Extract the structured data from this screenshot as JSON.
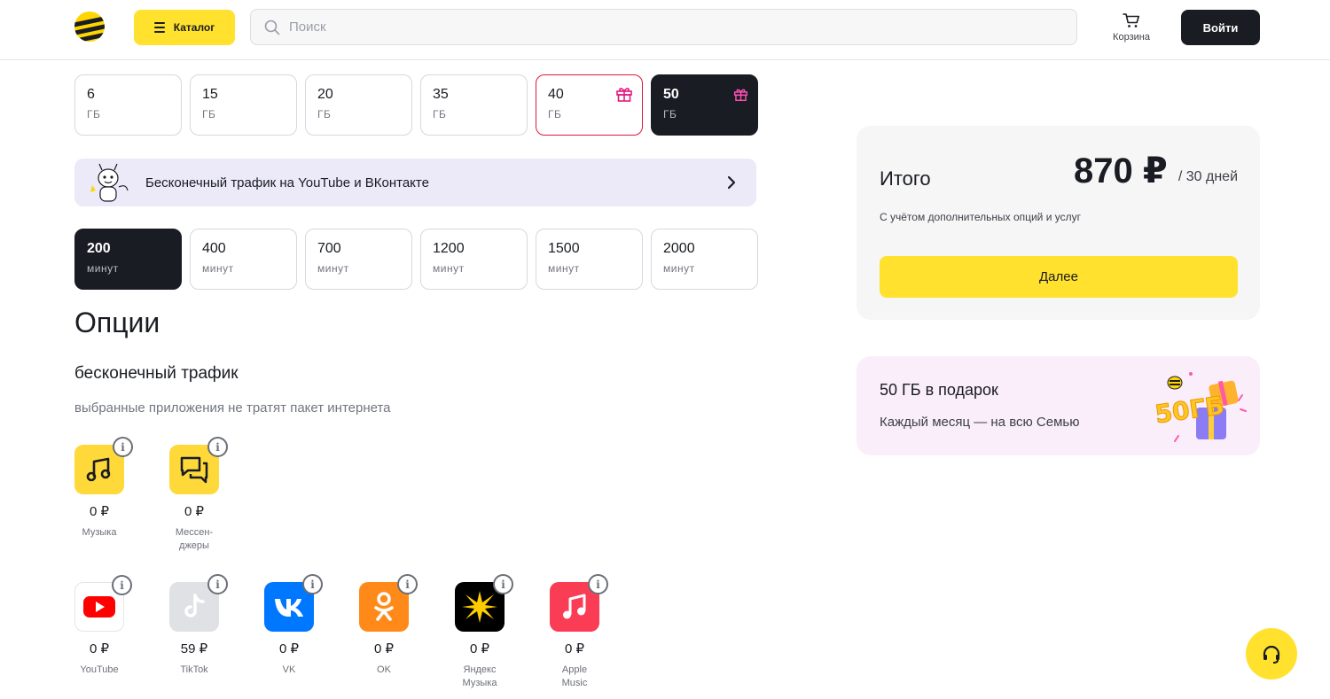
{
  "header": {
    "catalog_label": "Каталог",
    "search_placeholder": "Поиск",
    "search_value": "",
    "cart_label": "Корзина",
    "login_label": "Войти",
    "brand_color": "#ffe12e"
  },
  "traffic_options": [
    {
      "value": "6",
      "unit": "ГБ",
      "state": "default",
      "gift": false
    },
    {
      "value": "15",
      "unit": "ГБ",
      "state": "default",
      "gift": false
    },
    {
      "value": "20",
      "unit": "ГБ",
      "state": "default",
      "gift": false
    },
    {
      "value": "35",
      "unit": "ГБ",
      "state": "default",
      "gift": false
    },
    {
      "value": "40",
      "unit": "ГБ",
      "state": "outlined-red",
      "gift": true
    },
    {
      "value": "50",
      "unit": "ГБ",
      "state": "selected",
      "gift": true
    }
  ],
  "promo_banner": {
    "text": "Бесконечный трафик на YouTube и ВКонтакте",
    "background": "#ece9f8"
  },
  "minutes_options": [
    {
      "value": "200",
      "unit": "минут",
      "state": "selected"
    },
    {
      "value": "400",
      "unit": "минут",
      "state": "default"
    },
    {
      "value": "700",
      "unit": "минут",
      "state": "default"
    },
    {
      "value": "1200",
      "unit": "минут",
      "state": "default"
    },
    {
      "value": "1500",
      "unit": "минут",
      "state": "default"
    },
    {
      "value": "2000",
      "unit": "минут",
      "state": "default"
    }
  ],
  "options": {
    "title": "Опции",
    "unlimited": {
      "title": "бесконечный трафик",
      "description": "выбранные приложения не тратят пакет интернета"
    },
    "apps_row1": [
      {
        "name": "Музыка",
        "price": "0 ₽",
        "icon": "music-note-icon",
        "color": "#ffd83a"
      },
      {
        "name": "Мессен-джеры",
        "name_line1": "Мессен-",
        "name_line2": "джеры",
        "price": "0 ₽",
        "icon": "chat-bubbles-icon",
        "color": "#ffd83a"
      }
    ],
    "apps_row2": [
      {
        "name": "YouTube",
        "price": "0 ₽",
        "icon": "youtube-icon",
        "color": "#ffffff"
      },
      {
        "name": "TikTok",
        "price": "59 ₽",
        "icon": "tiktok-icon",
        "color": "#dfe1e5"
      },
      {
        "name": "VK",
        "price": "0 ₽",
        "icon": "vk-icon",
        "color": "#0077ff"
      },
      {
        "name": "OK",
        "price": "0 ₽",
        "icon": "odnoklassniki-icon",
        "color": "#ff8a1a"
      },
      {
        "name_line1": "Яндекс",
        "name_line2": "Музыка",
        "price": "0 ₽",
        "icon": "yandex-music-icon",
        "color": "#000000"
      },
      {
        "name_line1": "Apple",
        "name_line2": "Music",
        "price": "0 ₽",
        "icon": "apple-music-icon",
        "color": "#fa3c55"
      }
    ]
  },
  "summary": {
    "label": "Итого",
    "price": "870 ₽",
    "period": "/ 30 дней",
    "note": "С учётом дополнительных опций и услуг",
    "next_label": "Далее"
  },
  "gift_card": {
    "title": "50 ГБ в подарок",
    "description": "Каждый месяц — на всю Семью",
    "art_text": "50ГБ"
  }
}
